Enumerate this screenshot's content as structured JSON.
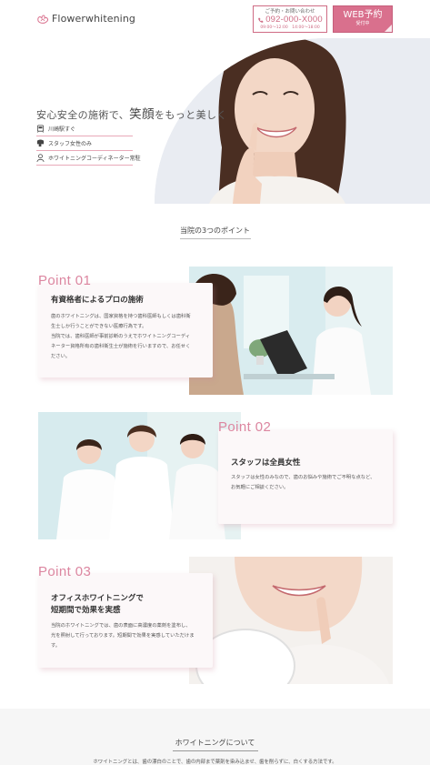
{
  "header": {
    "logo_text": "Flowerwhitening",
    "tel_caption": "ご予約・お問い合わせ",
    "tel_number": "092-000-X000",
    "tel_hours": "09:00〜12:00　14:00〜18:00",
    "web_label": "WEB予約",
    "web_sub": "受付中"
  },
  "hero": {
    "headline_pre": "安心安全の施術で、",
    "headline_em": "笑顔",
    "headline_post": "をもっと美しく",
    "features": [
      {
        "icon": "station-icon",
        "label": "川崎駅すぐ"
      },
      {
        "icon": "staff-icon",
        "label": "スタッフ女性のみ"
      },
      {
        "icon": "coordinator-icon",
        "label": "ホワイトニングコーディネーター常駐"
      }
    ]
  },
  "points": {
    "heading": "当院の3つのポイント",
    "items": [
      {
        "label": "Point 01",
        "title": "有資格者によるプロの施術",
        "body": [
          "歯のホワイトニングは、国家資格を持つ歯科医師もしくは歯科衛",
          "生士しか行うことができない医療行為です。",
          "当院では、歯科医師が事前診断のうえでホワイトニングコーディ",
          "ネーター資格所有の歯科衛生士が施術を行いますので、お任せく",
          "ださい。"
        ]
      },
      {
        "label": "Point 02",
        "title": "スタッフは全員女性",
        "body": [
          "スタッフは女性のみなので、歯のお悩みや施術でご不明な点など、",
          "お気軽にご相談ください。"
        ]
      },
      {
        "label": "Point 03",
        "title_lines": [
          "オフィスホワイトニングで",
          "短期間で効果を実感"
        ],
        "body": [
          "当院のホワイトニングでは、歯の表面に高濃度の薬剤を塗布し、",
          "光を照射して行っております。短期間で効果を実感していただけま",
          "す。"
        ]
      }
    ]
  },
  "about": {
    "heading": "ホワイトニングについて",
    "text": "ホワイトニングとは、歯の漂白のことで、歯の内部まで薬剤を染み込ませ、歯を削らずに、白くする方法です。"
  },
  "colors": {
    "accent": "#d9708d",
    "point_label": "#dc86a0",
    "card_bg": "#fcf8f9",
    "about_bg": "#f6f6f6"
  }
}
